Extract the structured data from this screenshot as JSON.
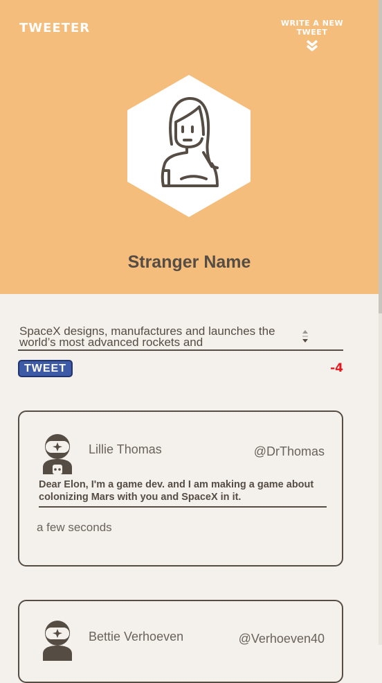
{
  "header": {
    "brand": "TWEETER",
    "write_link": "WRITE A NEW TWEET",
    "write_icon": "double-chevron-down-icon",
    "profile_name": "Stranger Name",
    "avatar_icon": "woman-avatar-icon"
  },
  "compose": {
    "text": "SpaceX designs, manufactures and launches the world’s most advanced rockets and",
    "button_label": "TWEET",
    "char_count": "-4"
  },
  "tweets": [
    {
      "name": "Lillie Thomas",
      "handle": "@DrThomas",
      "message": "Dear Elon, I'm a game dev. and I am making a game about colonizing Mars with you and SpaceX in it.",
      "time": "a few seconds",
      "avatar_icon": "astronaut-avatar-icon"
    },
    {
      "name": "Bettie Verhoeven",
      "handle": "@Verhoeven40",
      "avatar_icon": "astronaut-avatar-icon"
    }
  ],
  "colors": {
    "header_bg": "#f4bd7c",
    "page_bg": "#f4f1ec",
    "text_dark": "#554c44",
    "button_blue": "#3c5aa6",
    "count_red": "#e3171e"
  }
}
